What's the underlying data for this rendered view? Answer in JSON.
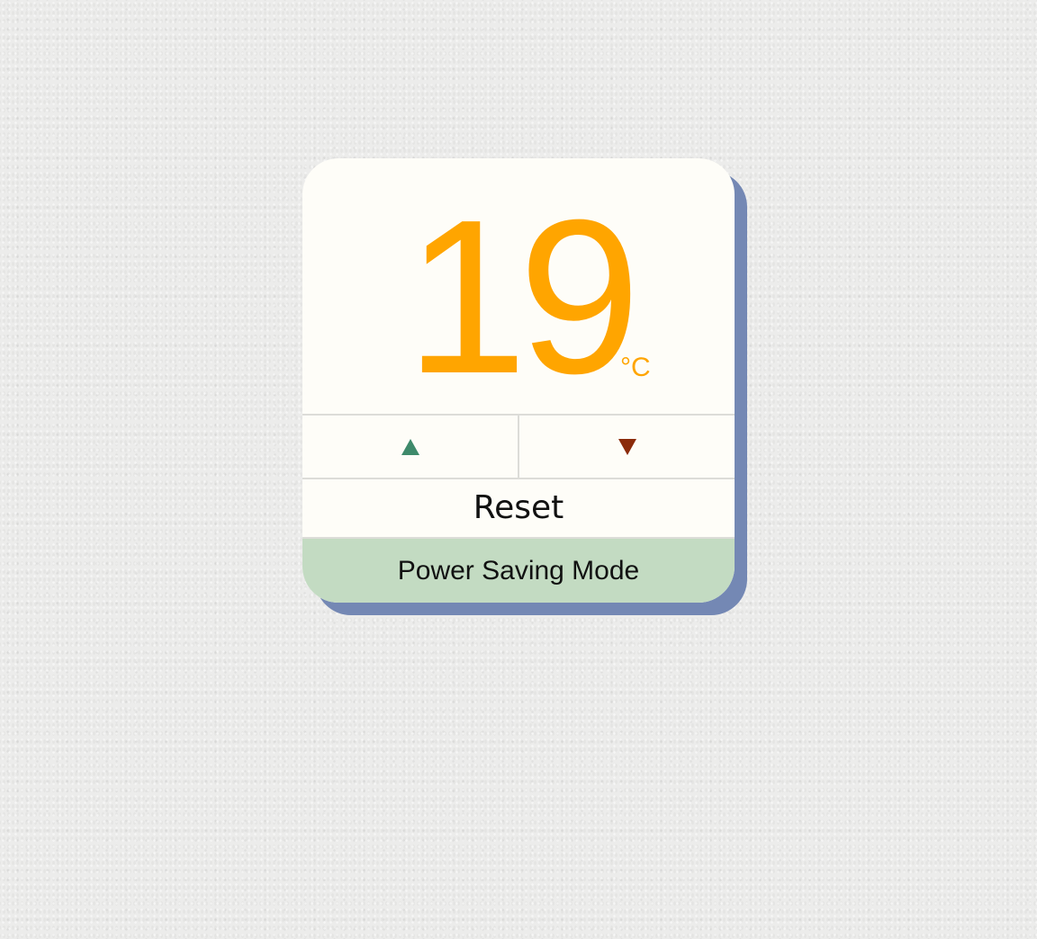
{
  "thermostat": {
    "temperature": "19",
    "unit": "°C",
    "increase_icon": "triangle-up-icon",
    "decrease_icon": "triangle-down-icon",
    "reset_label": "Reset",
    "mode_label": "Power Saving Mode"
  },
  "colors": {
    "temperature": "#ffa500",
    "increase": "#3e8a6b",
    "decrease": "#8b2b0b",
    "panel": "#fefdf8",
    "panel_shadow": "#7488b4",
    "mode_background": "#c3dbc2",
    "wall": "#ececeb"
  }
}
